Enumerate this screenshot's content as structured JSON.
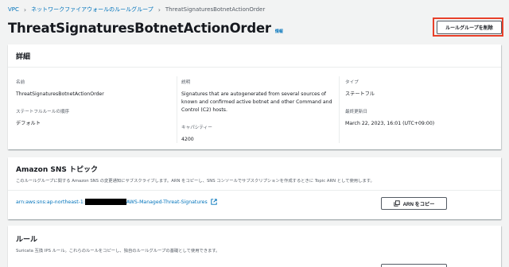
{
  "breadcrumb": {
    "items": [
      "VPC",
      "ネットワークファイアウォールのルールグループ"
    ],
    "current": "ThreatSignaturesBotnetActionOrder"
  },
  "header": {
    "title": "ThreatSignaturesBotnetActionOrder",
    "info": "情報",
    "delete_button": "ルールグループを削除"
  },
  "details": {
    "title": "詳細",
    "name_label": "名前",
    "name_value": "ThreatSignaturesBotnetActionOrder",
    "order_label": "ステートフルルールの順序",
    "order_value": "デフォルト",
    "desc_label": "説明",
    "desc_value": "Signatures that are autogenerated from several sources of known and confirmed active botnet and other Command and Control (C2) hosts.",
    "capacity_label": "キャパシティー",
    "capacity_value": "4200",
    "type_label": "タイプ",
    "type_value": "ステートフル",
    "updated_label": "最終更新日",
    "updated_value": "March 22, 2023, 16:01 (UTC+09:00)"
  },
  "sns": {
    "title": "Amazon SNS トピック",
    "description": "このルールグループに関する Amazon SNS の変更通知にサブスクライブします。ARN をコピーし、SNS コンソールでサブスクリプションを作成するときに Topic ARN として使用します。",
    "arn_prefix": "arn:aws:sns:ap-northeast-1:",
    "arn_suffix": "AWS-Managed-Threat-Signatures",
    "copy_button": "ARN をコピー"
  },
  "rules": {
    "title": "ルール",
    "description": "Suricata 互換 IPS ルール。これらのルールをコピーし、独自のルールグループの基礎として使用できます。"
  },
  "colors": {
    "link": "#0073bb",
    "highlight": "#e8402a",
    "background": "#f2f3f3"
  }
}
